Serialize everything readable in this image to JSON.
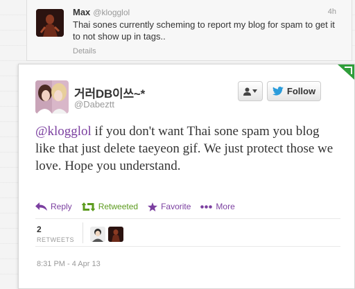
{
  "parent_tweet": {
    "name": "Max",
    "handle": "@klogglol",
    "time": "4h",
    "text": "Thai sones currently scheming to report my blog for spam to get it to not show up in tags..",
    "details_label": "Details"
  },
  "main_tweet": {
    "name": "거러DB이쓰~*",
    "handle": "@Dabeztt",
    "follow_label": "Follow",
    "mention": "@klogglol",
    "text": " if you don't want Thai sone spam you blog  like that just delete taeyeon gif. We just protect those we love. Hope you understand.",
    "actions": {
      "reply": "Reply",
      "retweeted": "Retweeted",
      "favorite": "Favorite",
      "more": "More"
    },
    "stats": {
      "retweets_count": "2",
      "retweets_label": "RETWEETS"
    },
    "timestamp": "8:31 PM - 4 Apr 13"
  },
  "colors": {
    "link": "#7b3fa0",
    "retweet_green": "#5c9b1e",
    "twitter_blue": "#2b9cdb",
    "corner_green": "#2f9e3a"
  },
  "icons": {
    "user_menu": "person-icon",
    "follow": "twitter-bird-icon",
    "reply": "reply-arrow-icon",
    "retweet": "retweet-icon",
    "favorite": "star-icon",
    "more": "dots-icon"
  }
}
